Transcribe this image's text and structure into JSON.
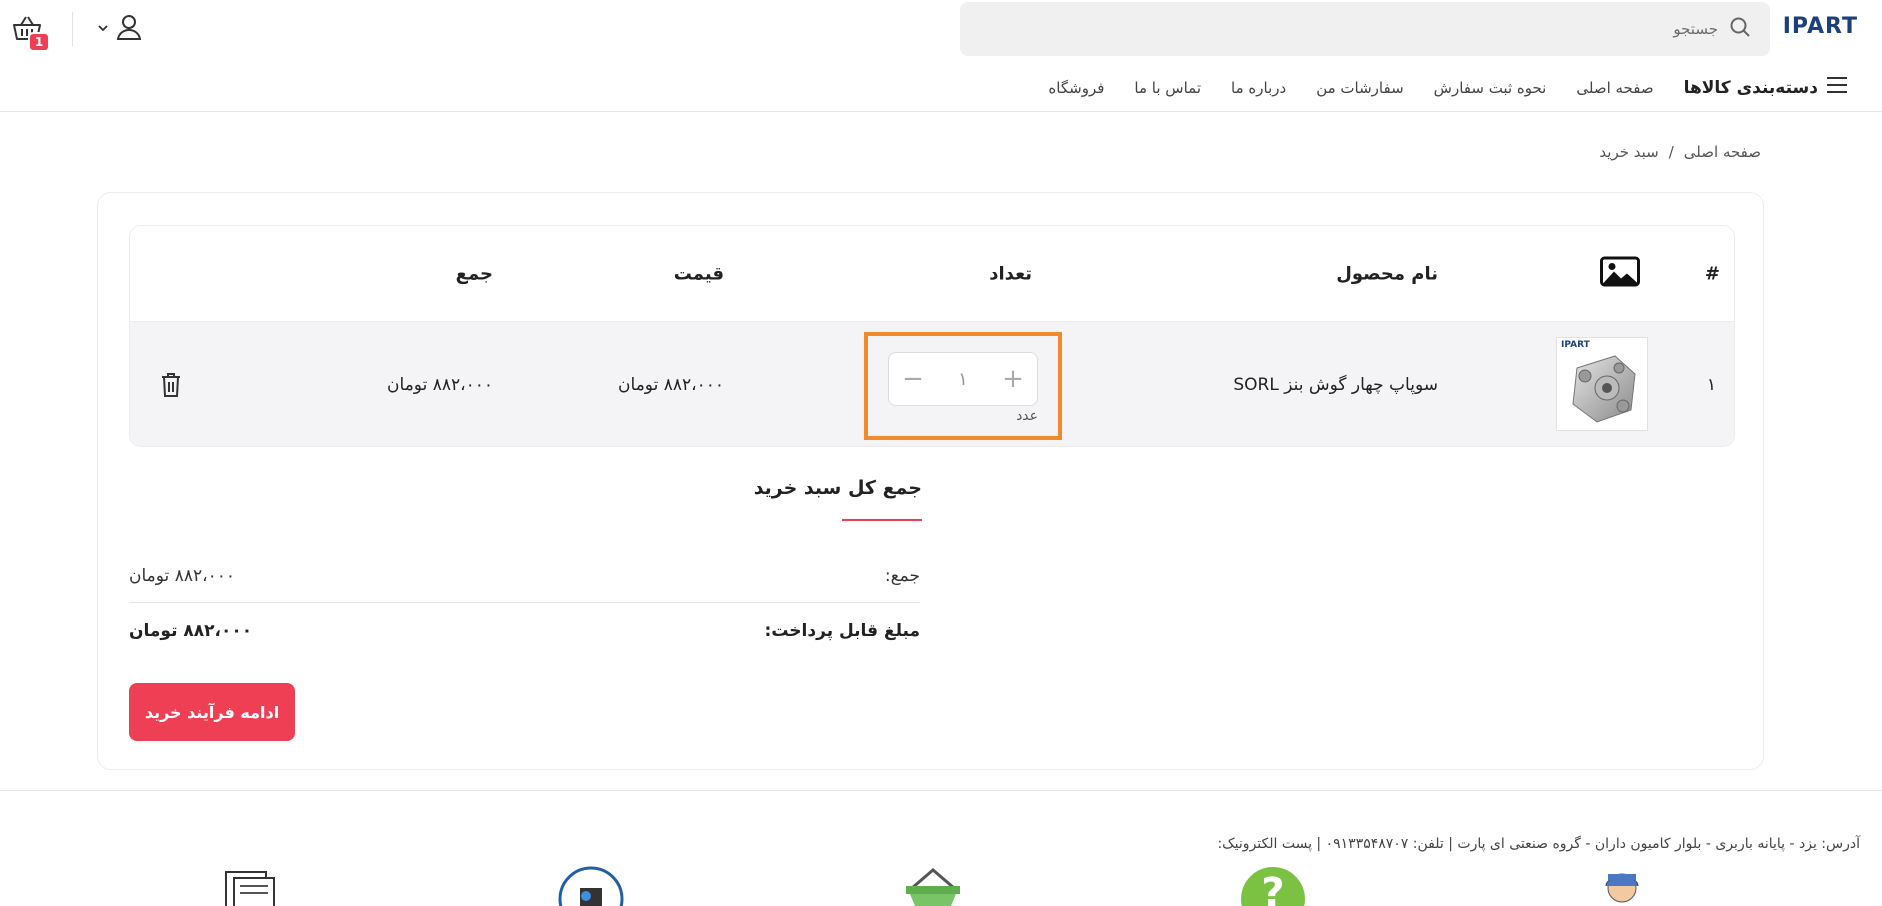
{
  "header": {
    "logo": "IPART",
    "search_placeholder": "جستجو",
    "cart_count": "1"
  },
  "nav": {
    "categories_label": "دسته‌بندی کالاها",
    "items": [
      "صفحه اصلی",
      "نحوه ثبت سفارش",
      "سفارشات من",
      "درباره ما",
      "تماس با ما",
      "فروشگاه"
    ]
  },
  "breadcrumb": {
    "home": "صفحه اصلی",
    "separator": "/",
    "current": "سبد خرید"
  },
  "table": {
    "headers": {
      "index": "#",
      "image": "image-icon",
      "product_name": "نام محصول",
      "quantity": "تعداد",
      "price": "قیمت",
      "total": "جمع"
    },
    "rows": [
      {
        "index": "۱",
        "product_name": "سوپاپ چهار گوش بنز SORL",
        "thumb_brand": "IPART",
        "quantity": "۱",
        "unit": "عدد",
        "price": "۸۸۲،۰۰۰ تومان",
        "total": "۸۸۲،۰۰۰ تومان"
      }
    ]
  },
  "summary": {
    "title": "جمع کل سبد خرید",
    "subtotal_label": "جمع:",
    "subtotal_value": "۸۸۲،۰۰۰ تومان",
    "payable_label": "مبلغ قابل پرداخت:",
    "payable_value": "۸۸۲،۰۰۰ تومان",
    "checkout_label": "ادامه فرآیند خرید"
  },
  "footer": {
    "address": "آدرس: یزد - پایانه باربری - بلوار کامیون داران - گروه صنعتی ای پارت | تلفن: ۰۹۱۳۳۵۴۸۷۰۷ | پست الکترونیک:"
  },
  "colors": {
    "accent": "#ef3f55",
    "focus_outline": "#f08a2c",
    "logo": "#1d3f7a"
  }
}
